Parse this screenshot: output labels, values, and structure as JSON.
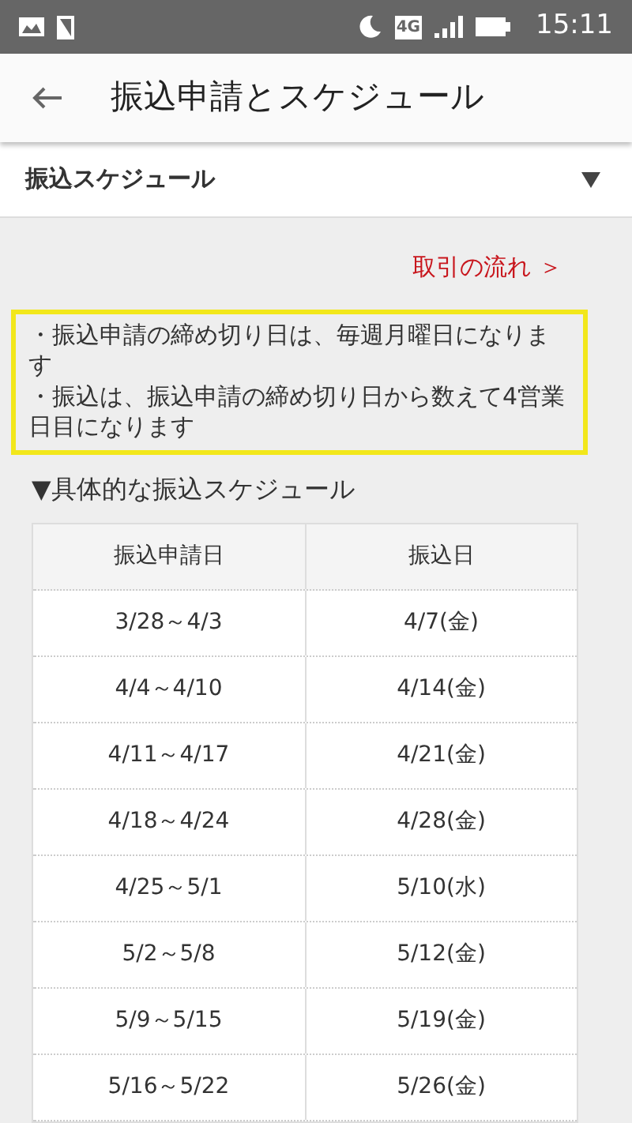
{
  "status_bar": {
    "time": "15:11",
    "network": "4G"
  },
  "app_bar": {
    "title": "振込申請とスケジュール"
  },
  "section": {
    "title": "振込スケジュール",
    "expanded": true
  },
  "link": {
    "label": "取引の流れ ＞"
  },
  "notice": [
    "・振込申請の締め切り日は、毎週月曜日になります",
    "・振込は、振込申請の締め切り日から数えて4営業日目になります"
  ],
  "schedule_heading": "▼具体的な振込スケジュール",
  "table": {
    "columns": [
      "振込申請日",
      "振込日"
    ],
    "rows": [
      [
        "3/28～4/3",
        "4/7(金)"
      ],
      [
        "4/4～4/10",
        "4/14(金)"
      ],
      [
        "4/11～4/17",
        "4/21(金)"
      ],
      [
        "4/18～4/24",
        "4/28(金)"
      ],
      [
        "4/25～5/1",
        "5/10(水)"
      ],
      [
        "5/2～5/8",
        "5/12(金)"
      ],
      [
        "5/9～5/15",
        "5/19(金)"
      ],
      [
        "5/16～5/22",
        "5/26(金)"
      ]
    ]
  }
}
